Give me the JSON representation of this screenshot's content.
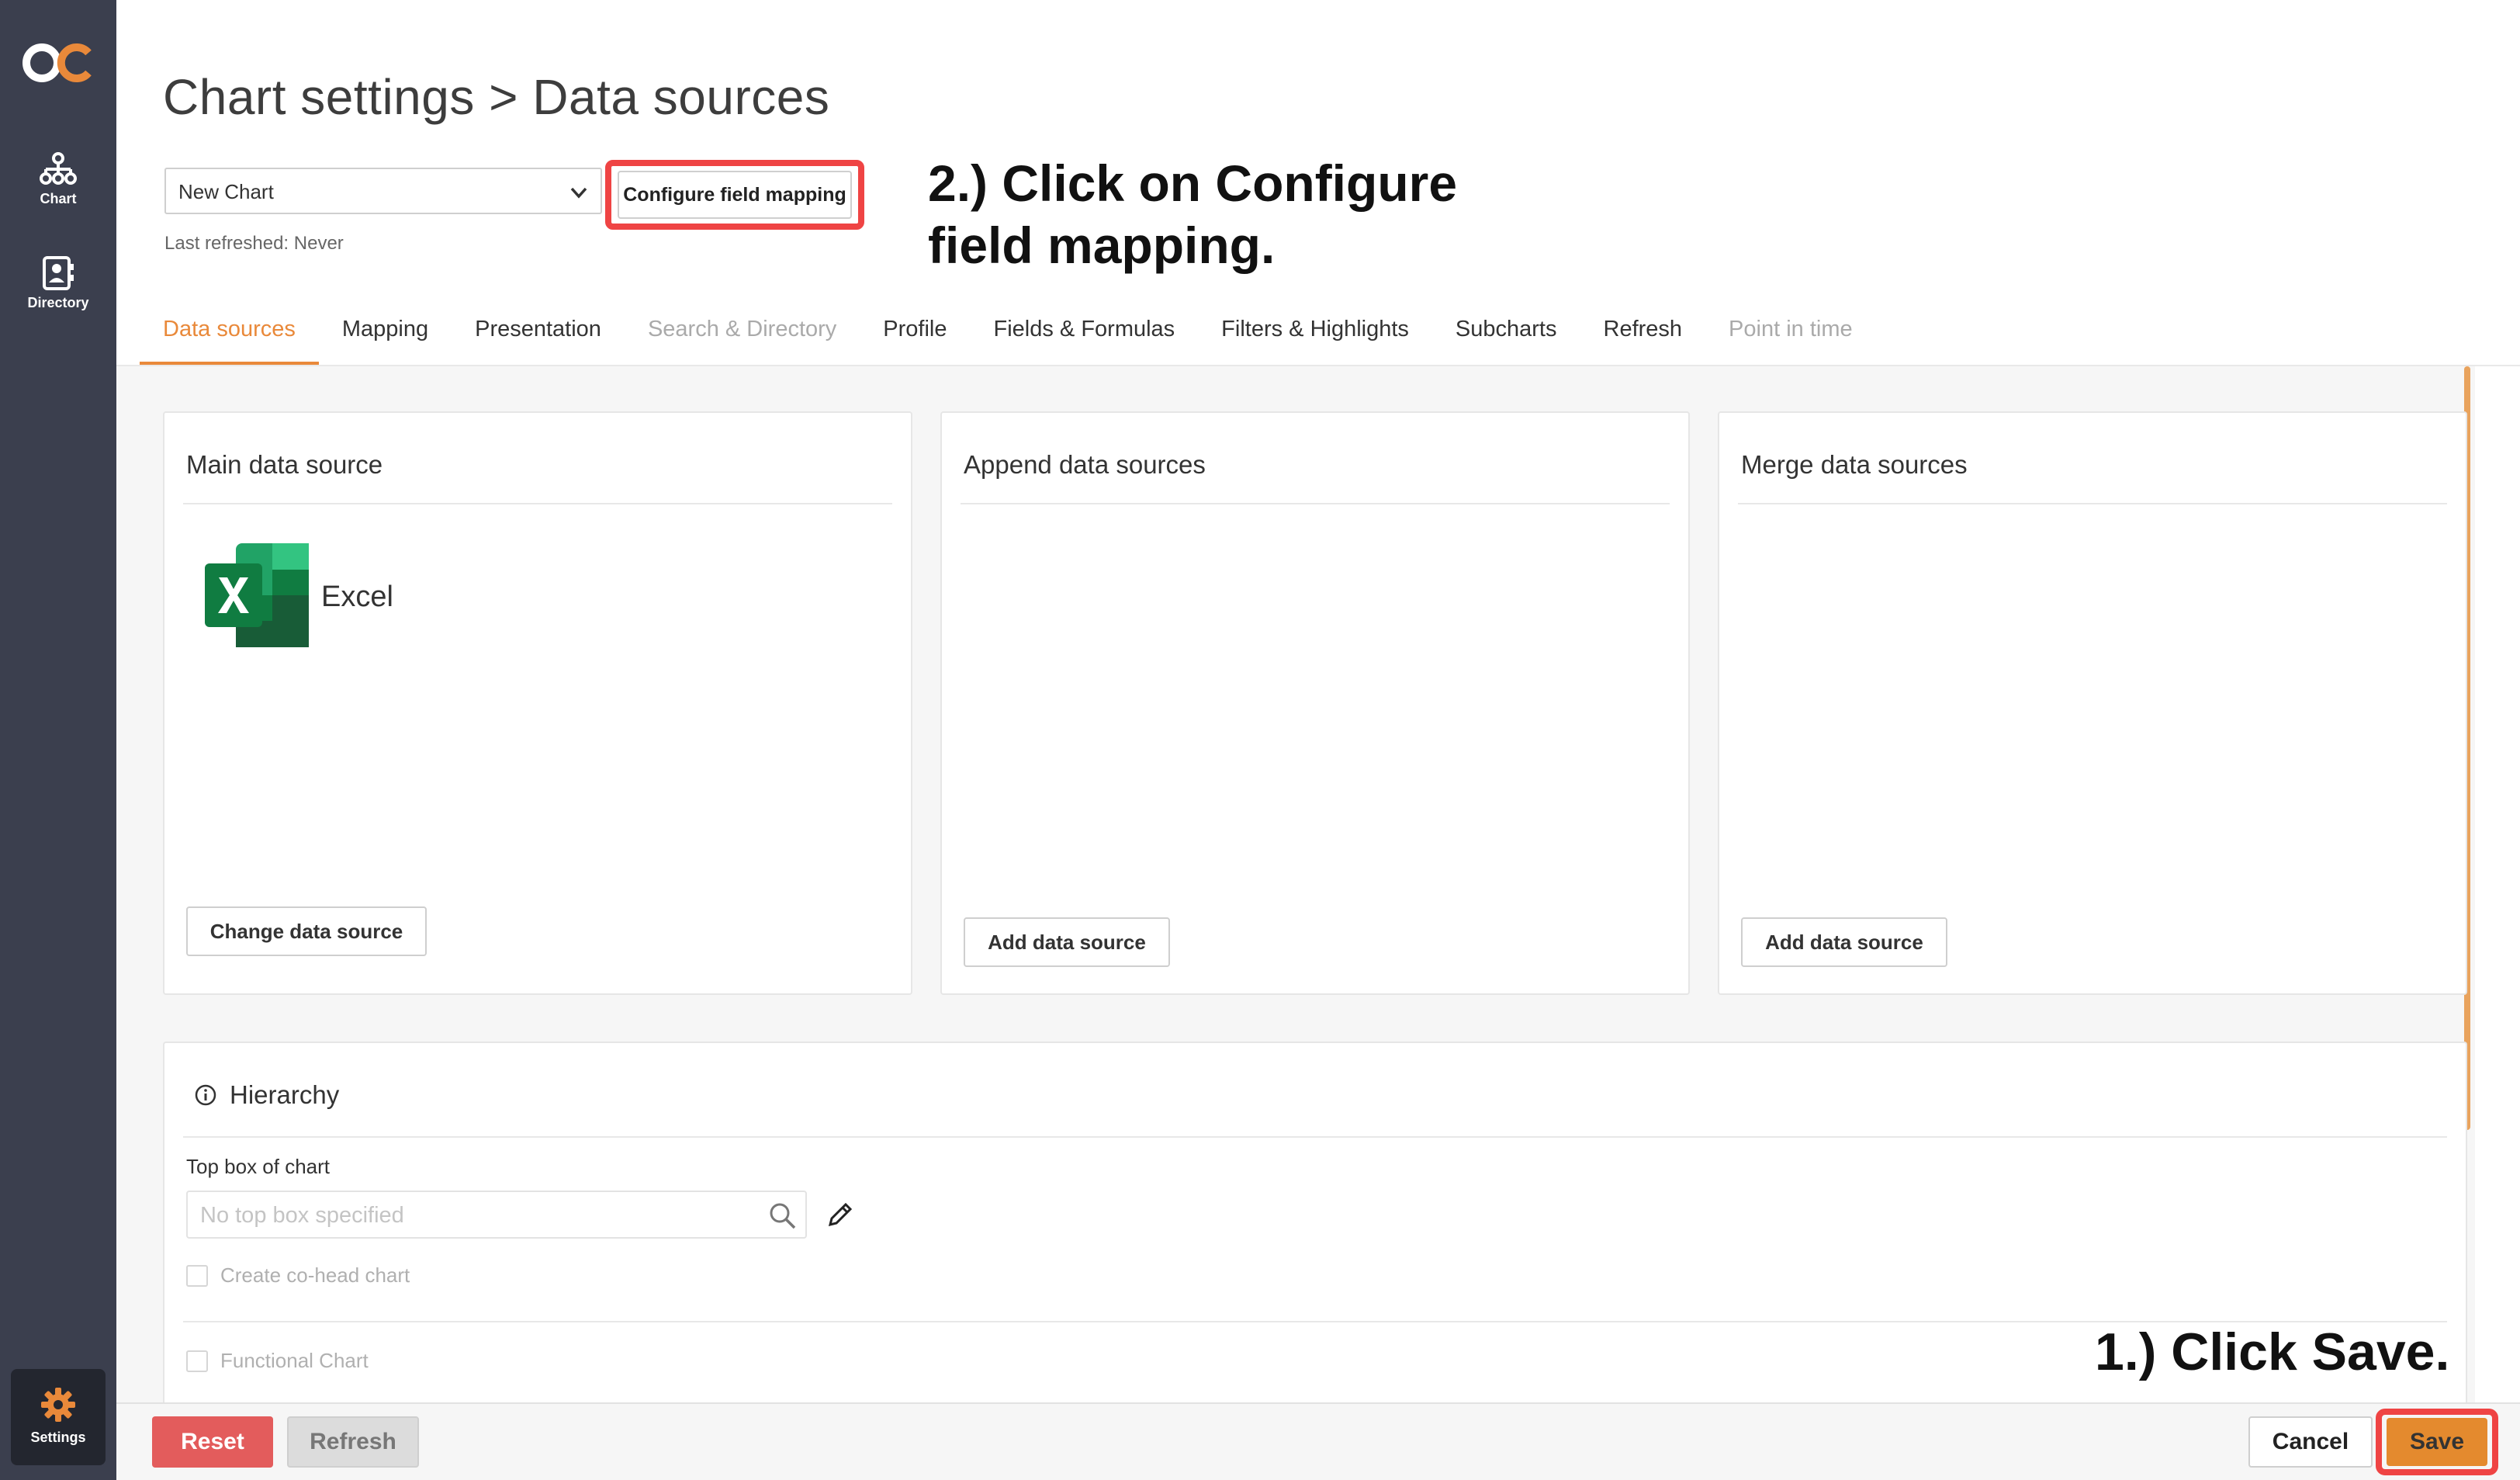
{
  "nav": {
    "chart_label": "Chart",
    "directory_label": "Directory",
    "settings_label": "Settings"
  },
  "header": {
    "title": "Chart settings > Data sources",
    "chart_select_value": "New Chart",
    "last_refreshed": "Last refreshed: Never",
    "configure_button": "Configure field mapping"
  },
  "annotations": {
    "step2_line1": "2.) Click on Configure",
    "step2_line2": "field mapping.",
    "step1": "1.) Click Save."
  },
  "tabs": [
    {
      "label": "Data sources",
      "state": "active"
    },
    {
      "label": "Mapping",
      "state": "normal"
    },
    {
      "label": "Presentation",
      "state": "normal"
    },
    {
      "label": "Search & Directory",
      "state": "disabled"
    },
    {
      "label": "Profile",
      "state": "normal"
    },
    {
      "label": "Fields & Formulas",
      "state": "normal"
    },
    {
      "label": "Filters & Highlights",
      "state": "normal"
    },
    {
      "label": "Subcharts",
      "state": "normal"
    },
    {
      "label": "Refresh",
      "state": "normal"
    },
    {
      "label": "Point in time",
      "state": "disabled"
    }
  ],
  "cards": {
    "main": {
      "title": "Main data source",
      "source_name": "Excel",
      "button": "Change data source"
    },
    "append": {
      "title": "Append data sources",
      "button": "Add data source"
    },
    "merge": {
      "title": "Merge data sources",
      "button": "Add data source"
    }
  },
  "hierarchy": {
    "title": "Hierarchy",
    "top_box_label": "Top box of chart",
    "top_box_placeholder": "No top box specified",
    "cohead_label": "Create co-head chart",
    "functional_label": "Functional Chart"
  },
  "footer": {
    "reset": "Reset",
    "refresh": "Refresh",
    "cancel": "Cancel",
    "save": "Save"
  },
  "colors": {
    "accent": "#e9893a",
    "nav_bg": "#3b3f4e",
    "highlight": "#ef4444",
    "reset": "#e35c5c",
    "save": "#e48a2e"
  }
}
